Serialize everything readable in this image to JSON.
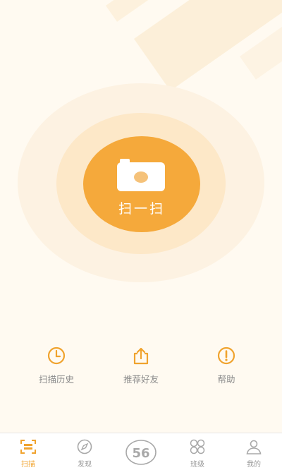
{
  "colors": {
    "accent": "#f5a93b",
    "accent_dark": "#f0a32e",
    "inactive": "#9a9a9a",
    "background": "#fffaf1"
  },
  "scan": {
    "label": "扫一扫",
    "icon": "camera-icon"
  },
  "actions": [
    {
      "label": "扫描历史",
      "icon": "clock-icon"
    },
    {
      "label": "推荐好友",
      "icon": "share-icon"
    },
    {
      "label": "帮助",
      "icon": "alert-icon"
    }
  ],
  "tabbar": {
    "items": [
      {
        "label": "扫描",
        "icon": "scan-icon",
        "active": true
      },
      {
        "label": "发现",
        "icon": "compass-icon",
        "active": false
      },
      {
        "label": "",
        "icon": "logo-56-icon",
        "active": false
      },
      {
        "label": "班级",
        "icon": "grid-icon",
        "active": false
      },
      {
        "label": "我的",
        "icon": "person-icon",
        "active": false
      }
    ],
    "logo_text": "56"
  }
}
